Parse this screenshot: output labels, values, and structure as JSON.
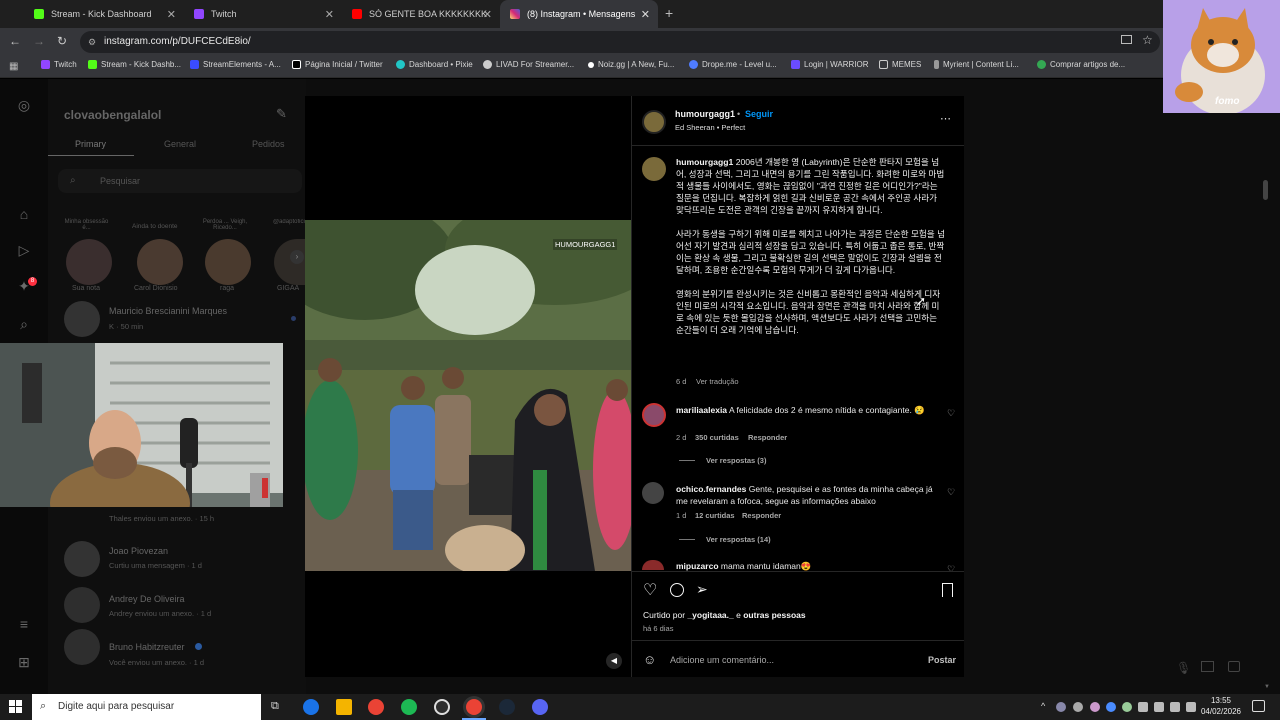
{
  "browser": {
    "tabs": [
      {
        "title": "Stream - Kick Dashboard",
        "color": "#53fc18"
      },
      {
        "title": "Twitch",
        "color": "#9146ff"
      },
      {
        "title": "SÓ GENTE BOA KKKKKKKK - Yo",
        "color": "#ff0000"
      },
      {
        "title": "(8) Instagram • Mensagens",
        "color": "#d6249f"
      }
    ],
    "url": "instagram.com/p/DUFCECdE8io/",
    "bookmarks": [
      {
        "label": "Twitch",
        "color": "#9146ff"
      },
      {
        "label": "Stream - Kick Dashb...",
        "color": "#53fc18"
      },
      {
        "label": "StreamElements - A...",
        "color": "#3a4cff"
      },
      {
        "label": "Página Inicial / Twitter",
        "color": "#ffffff"
      },
      {
        "label": "Dashboard • Pixie",
        "color": "#21c6c6"
      },
      {
        "label": "LIVAD For Streamer...",
        "color": "#cccccc"
      },
      {
        "label": "Noiz.gg | A New, Fu...",
        "color": "#ffffff"
      },
      {
        "label": "Drope.me - Level u...",
        "color": "#4f7cff"
      },
      {
        "label": "Login | WARRIOR",
        "color": "#6a4cff"
      },
      {
        "label": "MEMES",
        "color": "#cccccc"
      },
      {
        "label": "Myrient | Content Li...",
        "color": "#999999"
      },
      {
        "label": "Comprar artigos de...",
        "color": "#34a853"
      }
    ]
  },
  "dm": {
    "username": "clovaobengalalol",
    "tabs": [
      "Primary",
      "General",
      "Pedidos"
    ],
    "search_placeholder": "Pesquisar",
    "stories": [
      {
        "caption_top": "Minha obsessão é...",
        "name": "Sua nota"
      },
      {
        "caption_top": "Ainda to doente",
        "name": "Carol Dionisio"
      },
      {
        "caption_top": "Perdoa ... Veigh, Ricedo...",
        "name": "raga"
      },
      {
        "caption_top": "@adaptoficia",
        "name": "GIGAA"
      }
    ],
    "conversations": [
      {
        "name": "Mauricio Brescianini Marques",
        "sub": "K · 50 min"
      },
      {
        "name": "",
        "sub": "Thales enviou um anexo. · 15 h"
      },
      {
        "name": "Joao Piovezan",
        "sub": "Curtiu uma mensagem · 1 d"
      },
      {
        "name": "Andrey De Oliveira",
        "sub": "Andrey enviou um anexo. · 1 d"
      },
      {
        "name": "Bruno Habitzreuter",
        "sub": "Você enviou um anexo. · 1 d"
      }
    ],
    "badge": "8"
  },
  "video": {
    "watermark": "HUMOURGAGG1"
  },
  "post": {
    "author": "humourgagg1",
    "follow": "Seguir",
    "audio": "Ed Sheeran • Perfect",
    "caption_user": "humourgagg1",
    "caption_p1": "2006년 개봉한 영 (Labyrinth)은 단순한 판타지 모험을 넘어, 성장과 선택, 그리고 내면의 용기를 그린 작품입니다. 화려한 미로와 마법적 생물들 사이에서도, 영화는 끊임없이 \"과연 진정한 길은 어디인가?\"라는 질문을 던집니다. 복잡하게 얽힌 길과 신비로운 공간 속에서 주인공 사라가 맞닥뜨리는 도전은 관객의 긴장을 끝까지 유지하게 합니다.",
    "caption_p2": "사라가 동생을 구하기 위해 미로를 헤치고 나아가는 과정은 단순한 모험을 넘어선 자기 발견과 심리적 성장을 담고 있습니다. 특히 어둡고 좁은 통로, 반짝이는 환상 속 생물, 그리고 불확실한 길의 선택은 말없이도 긴장과 설렘을 전달하며, 조용한 순간일수록 모험의 무게가 더 깊게 다가옵니다.",
    "caption_p3": "영화의 분위기를 완성시키는 것은 신비롭고 몽환적인 음악과 세심하게 디자인된 미로의 시각적 요소입니다. 음악과 장면은 관객을 마치 사라와 함께 미로 속에 있는 듯한 몰입감을 선사하며, 액션보다도 사라가 선택을 고민하는 순간들이 더 오래 기억에 남습니다.",
    "caption_time": "6 d",
    "see_translation": "Ver tradução",
    "comments": [
      {
        "user": "mariliaalexia",
        "text": "A felicidade dos 2 é mesmo nítida e contagiante. 😢",
        "time": "2 d",
        "likes": "350 curtidas",
        "reply": "Responder",
        "replies": "Ver respostas (3)"
      },
      {
        "user": "ochico.fernandes",
        "text": "Gente, pesquisei e as fontes da minha cabeça já me revelaram a fofoca, segue as informações abaixo",
        "time": "1 d",
        "likes": "12 curtidas",
        "reply": "Responder",
        "replies": "Ver respostas (14)"
      },
      {
        "user": "mipuzarco",
        "text": "mama mantu idaman😍"
      }
    ],
    "liked_by_prefix": "Curtido por",
    "liked_by_user": "_yogitaaa._",
    "liked_by_suffix": "e",
    "liked_by_others": "outras pessoas",
    "date": "há 6 dias",
    "comment_placeholder": "Adicione um comentário...",
    "post_button": "Postar"
  },
  "overlay": {
    "fomo_label": "fomo"
  },
  "taskbar": {
    "search_placeholder": "Digite aqui para pesquisar",
    "time": "13:55",
    "date": "04/02/2026",
    "app_colors": [
      "#1a73e8",
      "#f4b400",
      "#ea4335",
      "#1db954",
      "#2d2d2d",
      "#ea4335",
      "#1b2838",
      "#5865f2"
    ]
  }
}
